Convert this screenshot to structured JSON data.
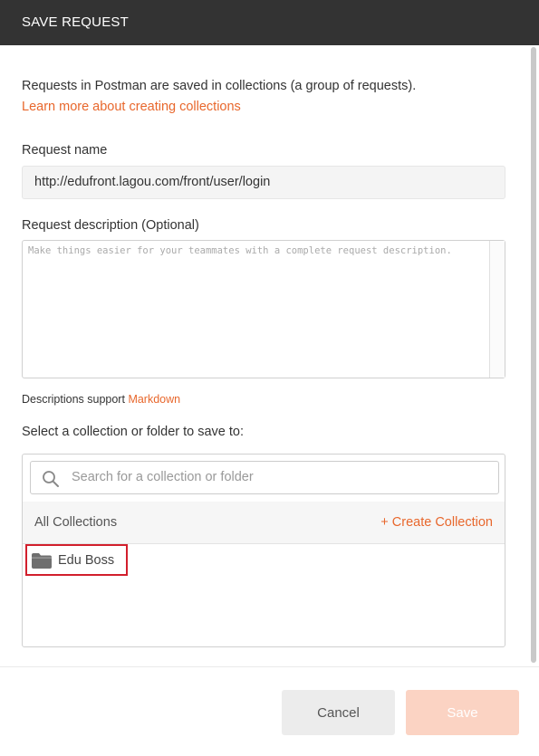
{
  "dialog": {
    "title": "SAVE REQUEST",
    "intro_text": "Requests in Postman are saved in collections (a group of requests).",
    "learn_more_link": "Learn more about creating collections"
  },
  "request_name": {
    "label": "Request name",
    "value": "http://edufront.lagou.com/front/user/login"
  },
  "request_description": {
    "label": "Request description (Optional)",
    "placeholder": "Make things easier for your teammates with a complete request description.",
    "support_prefix": "Descriptions support",
    "markdown_link": "Markdown"
  },
  "collection_picker": {
    "label": "Select a collection or folder to save to:",
    "search_placeholder": "Search for a collection or folder",
    "all_collections_label": "All Collections",
    "create_collection_link": "+ Create Collection",
    "items": [
      {
        "name": "Edu Boss",
        "icon": "folder-icon",
        "highlighted": true
      }
    ]
  },
  "buttons": {
    "cancel_label": "Cancel",
    "save_label": "Save"
  },
  "colors": {
    "header_bg": "#333333",
    "accent": "#e8672c",
    "save_disabled_bg": "#fbd3c3",
    "highlight_border": "#d21f2c"
  }
}
